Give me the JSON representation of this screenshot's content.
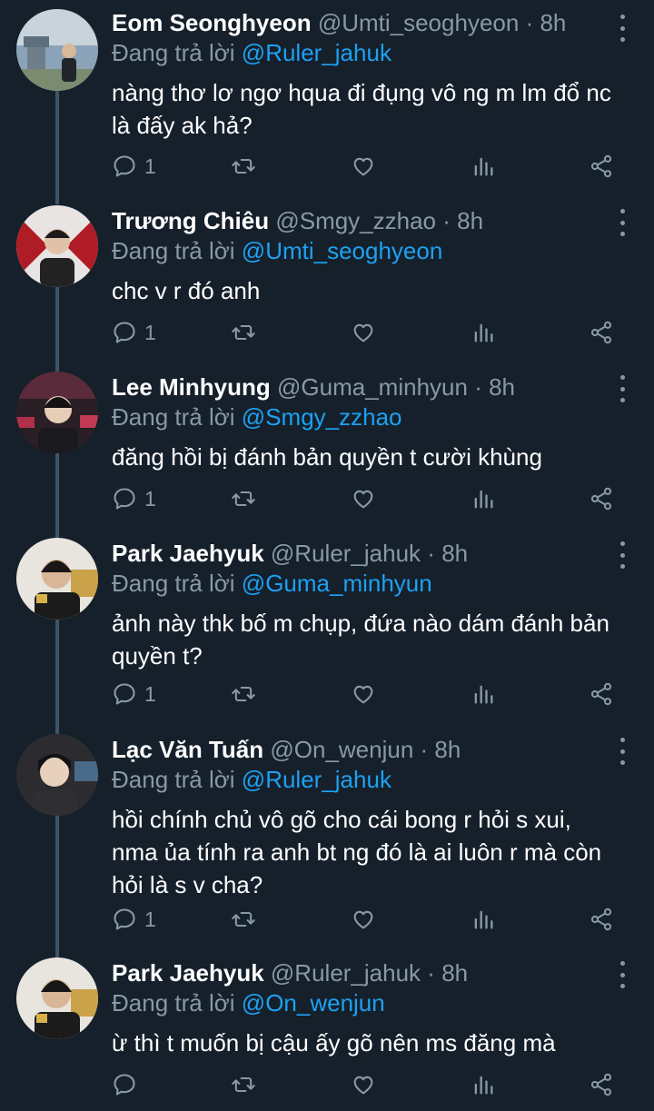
{
  "tweets": [
    {
      "name": "Eom Seonghyeon",
      "handle": "@Umti_seoghyeon",
      "dot": "·",
      "time": "8h",
      "replying_prefix": "Đang trả lời",
      "replying_to": "@Ruler_jahuk",
      "text": "nàng thơ lơ ngơ hqua đi đụng vô ng m lm đổ nc là đấy ak hả?",
      "reply_count": "1"
    },
    {
      "name": "Trương Chiêu",
      "handle": "@Smgy_zzhao",
      "dot": "·",
      "time": "8h",
      "replying_prefix": "Đang trả lời",
      "replying_to": "@Umti_seoghyeon",
      "text": "chc v r đó anh",
      "reply_count": "1"
    },
    {
      "name": "Lee Minhyung",
      "handle": "@Guma_minhyun",
      "dot": "·",
      "time": "8h",
      "replying_prefix": "Đang trả lời",
      "replying_to": "@Smgy_zzhao",
      "text": "đăng hồi bị đánh bản quyền t cười khùng",
      "reply_count": "1"
    },
    {
      "name": "Park Jaehyuk",
      "handle": "@Ruler_jahuk",
      "dot": "·",
      "time": "8h",
      "replying_prefix": "Đang trả lời",
      "replying_to": "@Guma_minhyun",
      "text": "ảnh này thk bố m chụp, đứa nào dám đánh bản\nquyền t?",
      "reply_count": "1"
    },
    {
      "name": "Lạc Văn Tuấn",
      "handle": "@On_wenjun",
      "dot": "·",
      "time": "8h",
      "replying_prefix": "Đang trả lời",
      "replying_to": "@Ruler_jahuk",
      "text": "hồi chính chủ vô gõ cho cái bong r hỏi s xui,\nnma ủa tính ra anh bt ng đó là ai luôn r mà còn\nhỏi là s v cha?",
      "reply_count": "1"
    },
    {
      "name": "Park Jaehyuk",
      "handle": "@Ruler_jahuk",
      "dot": "·",
      "time": "8h",
      "replying_prefix": "Đang trả lời",
      "replying_to": "@On_wenjun",
      "text": "ừ thì t muốn bị cậu ấy gõ nên ms đăng mà",
      "reply_count": ""
    }
  ],
  "icons": {
    "reply": "reply-icon",
    "retweet": "retweet-icon",
    "like": "heart-icon",
    "analytics": "analytics-icon",
    "share": "share-icon",
    "more": "more-vertical-icon"
  },
  "colors": {
    "background": "#15202b",
    "secondary_text": "#8899a6",
    "mention": "#1da1f2",
    "thread_line": "#3d5466"
  }
}
